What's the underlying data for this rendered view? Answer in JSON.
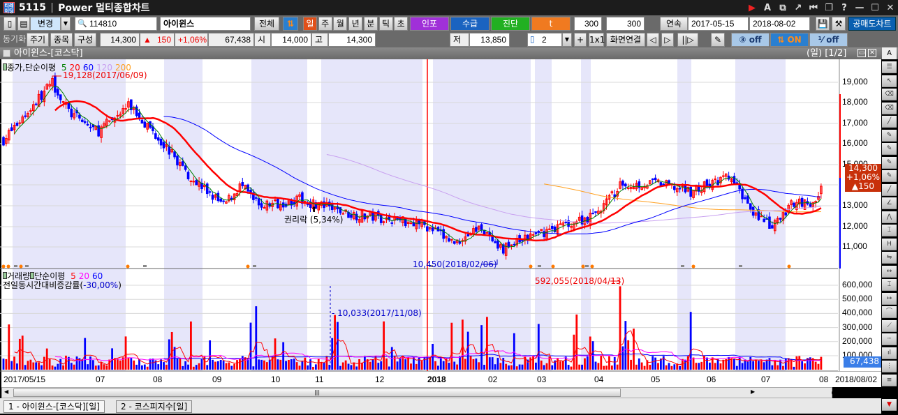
{
  "title": {
    "code": "5115",
    "name": "Power 멀티종합차트"
  },
  "toolbar1": {
    "change_label": "변경",
    "stock_code": "114810",
    "stock_name": "아이윈스",
    "all_label": "전체",
    "periods": [
      "일",
      "주",
      "월",
      "년",
      "분",
      "틱",
      "초"
    ],
    "active_period": "일",
    "info_label": "인포",
    "supply_label": "수급",
    "diag_label": "진단",
    "t_label": "t",
    "count1": "300",
    "count2": "300",
    "continuous_label": "연속",
    "start_date": "2017-05-15",
    "end_date": "2018-08-02",
    "short_chart_label": "공매도차트"
  },
  "toolbar2": {
    "sync_label": "동기화",
    "btn_period": "주기",
    "btn_item": "종목",
    "btn_config": "구성",
    "price": "14,300",
    "change": "150",
    "change_pct": "+1,06%",
    "volume": "67,438",
    "open_label": "시가",
    "open": "14,000",
    "high_label": "고가",
    "high": "14,300",
    "low_label": "저가",
    "low": "13,850",
    "layout_count": "2",
    "one_by_one": "1x1",
    "screen_link": "화면연결",
    "toggle1": "off",
    "toggle2": "ON",
    "toggle3": "off"
  },
  "chart_header": {
    "title": "아이윈스-[코스닥]",
    "period_page": "(일) [1/2]"
  },
  "price_panel": {
    "legend": "종가,단순이평",
    "mas": [
      {
        "p": "5",
        "color": "#008000"
      },
      {
        "p": "20",
        "color": "#ff0000"
      },
      {
        "p": "60",
        "color": "#0000ff"
      },
      {
        "p": "120",
        "color": "#c8a0f0"
      },
      {
        "p": "200",
        "color": "#ffa020"
      }
    ],
    "high_note": "19,128(2017/06/09)",
    "low_note": "10,450(2018/02/06)",
    "rights_note": "권리락 (5,34%)",
    "yticks": [
      "19,000",
      "18,000",
      "17,000",
      "16,000",
      "15,000",
      "13,000",
      "12,000",
      "11,000"
    ],
    "current": {
      "price": "14,300",
      "pct": "+1,06%",
      "change": "▲150"
    }
  },
  "volume_panel": {
    "legend": "거래량",
    "ma_label": "단순이평",
    "mas": [
      {
        "p": "5",
        "color": "#ff0000"
      },
      {
        "p": "20",
        "color": "#ff00ff"
      },
      {
        "p": "60",
        "color": "#0000ff"
      }
    ],
    "rate_label": "전일동시간대비증감률(",
    "rate": "-30,00%",
    "rate_close": ")",
    "low_note": "- 10,033(2017/11/08)",
    "high_note": "592,055(2018/04/13)",
    "yticks": [
      "600,000",
      "500,000",
      "400,000",
      "300,000",
      "200,000",
      "100,000"
    ],
    "current": "67,438"
  },
  "xaxis": {
    "ticks": [
      "2017/05/15",
      "07",
      "08",
      "09",
      "10",
      "11",
      "12",
      "2018",
      "02",
      "03",
      "04",
      "05",
      "06",
      "07",
      "08"
    ],
    "end": "2018/08/02"
  },
  "tabs": [
    "1 - 아이윈스-[코스닥][일]",
    "2 - 코스피지수[일]"
  ],
  "colors": {
    "up": "#ff0000",
    "down": "#0000ff",
    "band": "#e6e6fa"
  }
}
